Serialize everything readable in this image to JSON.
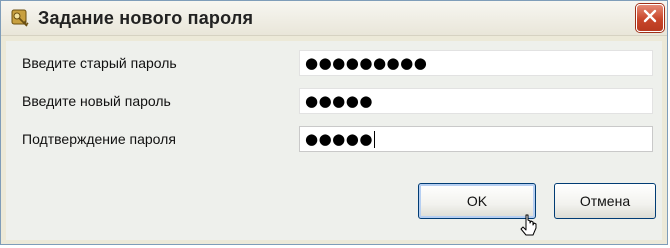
{
  "dialog": {
    "title": "Задание нового пароля",
    "icon": "keys-icon",
    "close_icon": "close-icon"
  },
  "fields": [
    {
      "label": "Введите старый пароль",
      "masked_value": "●●●●●●●●●"
    },
    {
      "label": "Введите новый пароль",
      "masked_value": "●●●●●"
    },
    {
      "label": "Подтверждение пароля",
      "masked_value": "●●●●●"
    }
  ],
  "buttons": {
    "ok_label": "OK",
    "cancel_label": "Отмена"
  },
  "colors": {
    "title_bg": "#f7f6f1",
    "client_bg": "#eef0ec",
    "close_red": "#c8462b",
    "button_border": "#003c74",
    "focus_blue": "#b6cff2"
  }
}
